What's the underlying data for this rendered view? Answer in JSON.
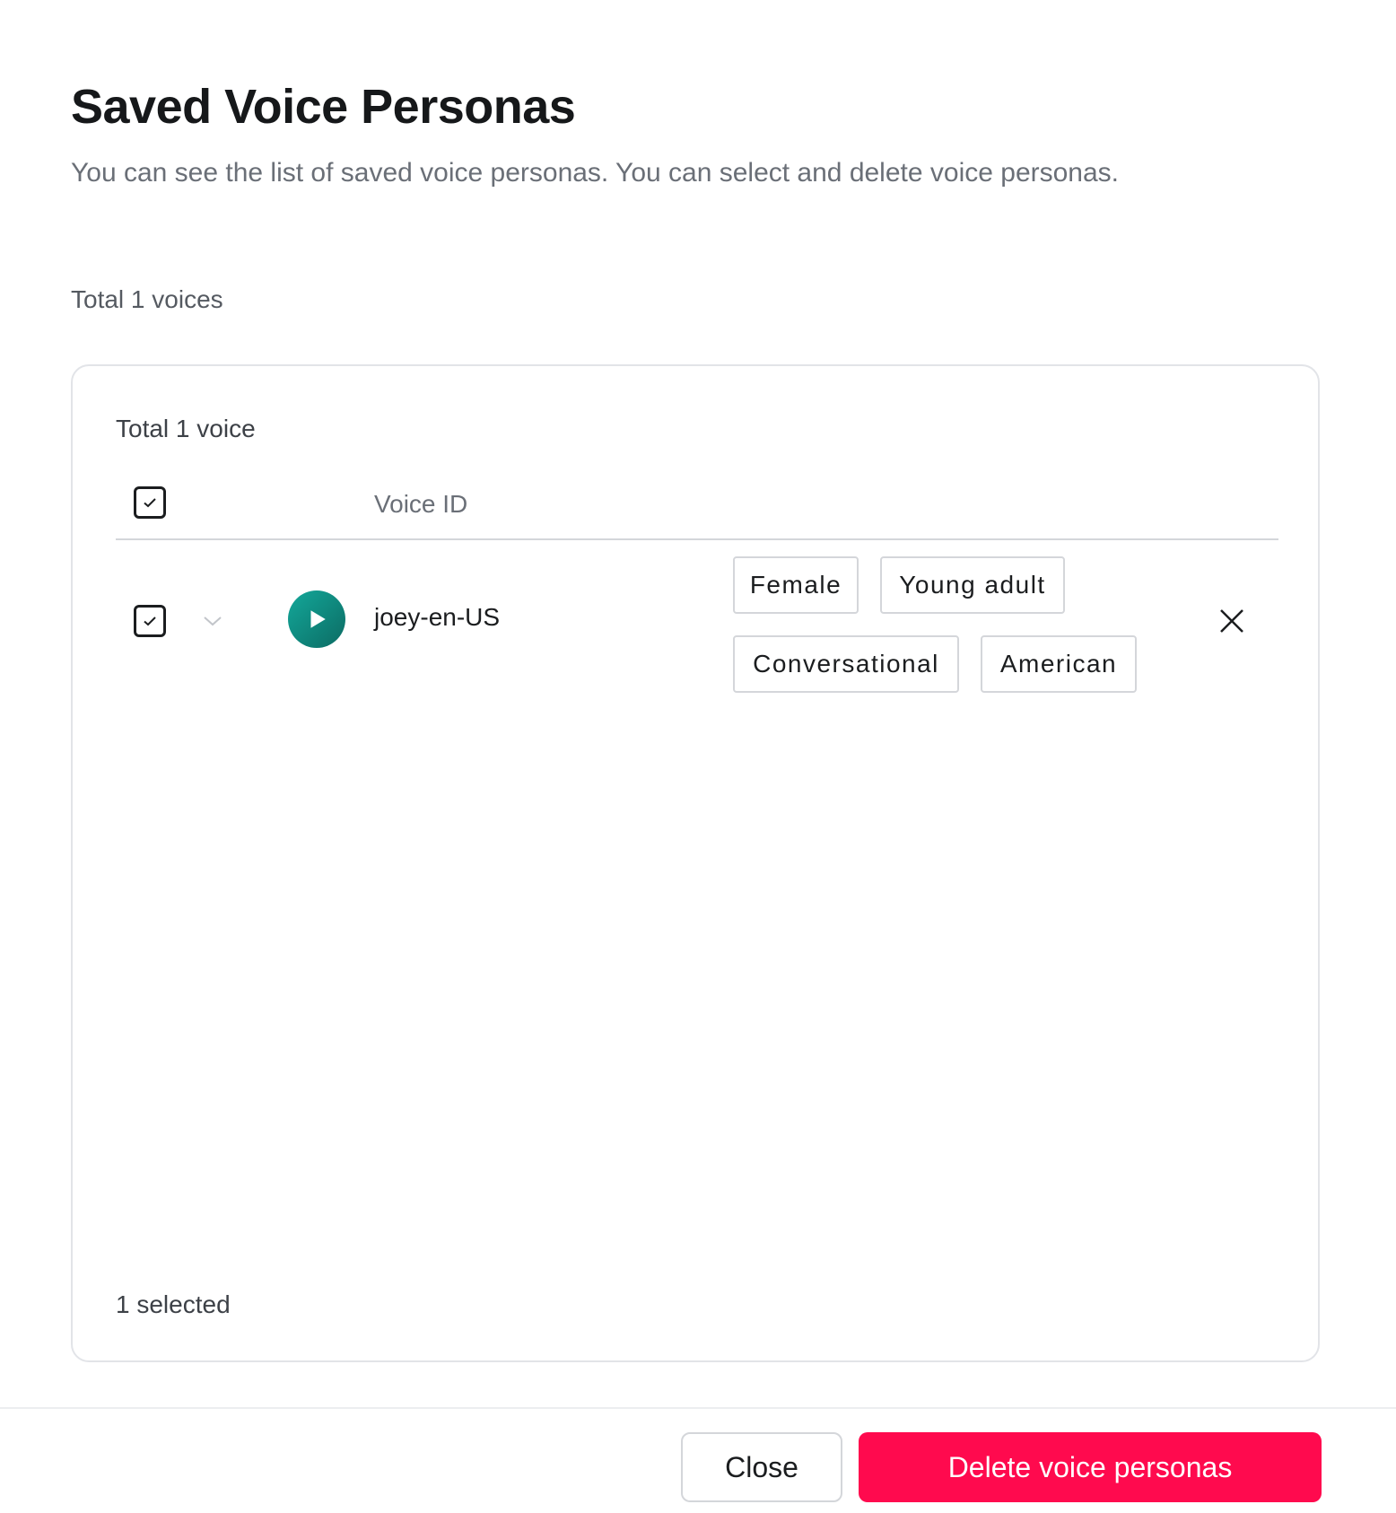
{
  "dialog": {
    "title": "Saved Voice Personas",
    "subtitle": "You can see the list of saved voice personas. You can select and delete voice personas.",
    "total_voices": "Total 1 voices"
  },
  "panel": {
    "total_label": "Total 1 voice",
    "columns": {
      "voice_id": "Voice ID"
    },
    "rows": [
      {
        "voice_id": "joey-en-US",
        "selected": true,
        "tags": [
          "Female",
          "Young adult",
          "Conversational",
          "American"
        ]
      }
    ],
    "selected_count": "1 selected"
  },
  "footer": {
    "close_label": "Close",
    "delete_label": "Delete voice personas"
  },
  "colors": {
    "accent": "#ff0a4e",
    "play_button": "#13a89a"
  },
  "icons": {
    "checkbox": "checkbox-checked-icon",
    "chevron": "chevron-down-icon",
    "play": "play-icon",
    "remove": "close-icon"
  }
}
